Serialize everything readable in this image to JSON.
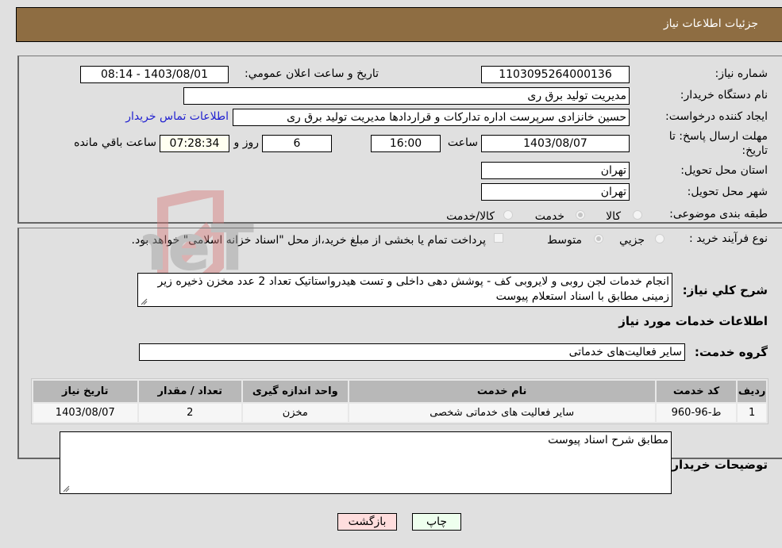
{
  "header": {
    "title": "جزئیات اطلاعات نیاز"
  },
  "fields": {
    "need_number": {
      "label": "شماره نیاز:",
      "value": "1103095264000136"
    },
    "announce_datetime": {
      "label": "تاریخ و ساعت اعلان عمومي:",
      "value": "1403/08/01 - 08:14"
    },
    "buyer_org": {
      "label": "نام دستگاه خریدار:",
      "value": "مدیریت تولید برق ری"
    },
    "requester": {
      "label": "ایجاد کننده درخواست:",
      "value": "حسین خانزادی سرپرست اداره تدارکات و قراردادها مدیریت تولید برق ری",
      "contact_link": "اطلاعات تماس خریدار"
    },
    "deadline": {
      "label_line1": "مهلت ارسال پاسخ: تا",
      "label_line2": "تاریخ:",
      "date": "1403/08/07",
      "time_label": "ساعت",
      "time": "16:00",
      "days": "6",
      "days_label": "روز و",
      "remaining": "07:28:34",
      "remaining_label": "ساعت باقي مانده"
    },
    "province": {
      "label": "استان محل تحویل:",
      "value": "تهران"
    },
    "city": {
      "label": "شهر محل تحویل:",
      "value": "تهران"
    },
    "category": {
      "label": "طبقه بندی موضوعی:",
      "options": [
        {
          "label": "کالا",
          "checked": false
        },
        {
          "label": "خدمت",
          "checked": true
        },
        {
          "label": "کالا/خدمت",
          "checked": false
        }
      ]
    },
    "purchase_type": {
      "label": "نوع فرآیند خرید :",
      "options": [
        {
          "label": "جزيي",
          "checked": false
        },
        {
          "label": "متوسط",
          "checked": true
        }
      ],
      "treasury_checkbox_label": "پرداخت تمام یا بخشی از مبلغ خرید،از محل \"اسناد خزانه اسلامی\" خواهد بود.",
      "treasury_checked": false
    }
  },
  "description": {
    "label": "شرح کلي نیاز:",
    "value": "انجام خدمات  لجن روبی  و لایروبی کف - پوشش دهی داخلی و تست هیدرواستاتیک تعداد 2 عدد مخزن ذخیره زیر زمینی مطابق با اسناد استعلام پیوست"
  },
  "services_section": {
    "title": "اطلاعات خدمات مورد نیاز",
    "group_label": "گروه خدمت:",
    "group_value": "سایر فعالیت‌های خدماتی",
    "table": {
      "headers": [
        "ردیف",
        "کد خدمت",
        "نام خدمت",
        "واحد اندازه گیری",
        "تعداد / مقدار",
        "تاریخ نیاز"
      ],
      "rows": [
        [
          "1",
          "ط-96-960",
          "سایر فعالیت های خدماتی شخصی",
          "مخزن",
          "2",
          "1403/08/07"
        ]
      ]
    }
  },
  "buyer_notes": {
    "label": "توضیحات خریدار:",
    "value": "مطابق شرح اسناد پیوست"
  },
  "buttons": {
    "print": "چاپ",
    "back": "بازگشت"
  },
  "watermark": {
    "text": "AriaTender.neT"
  },
  "colors": {
    "header_bg": "#8e6d42",
    "print_bg": "#eeffee",
    "back_bg": "#ffdddd",
    "link": "#2020d0"
  }
}
